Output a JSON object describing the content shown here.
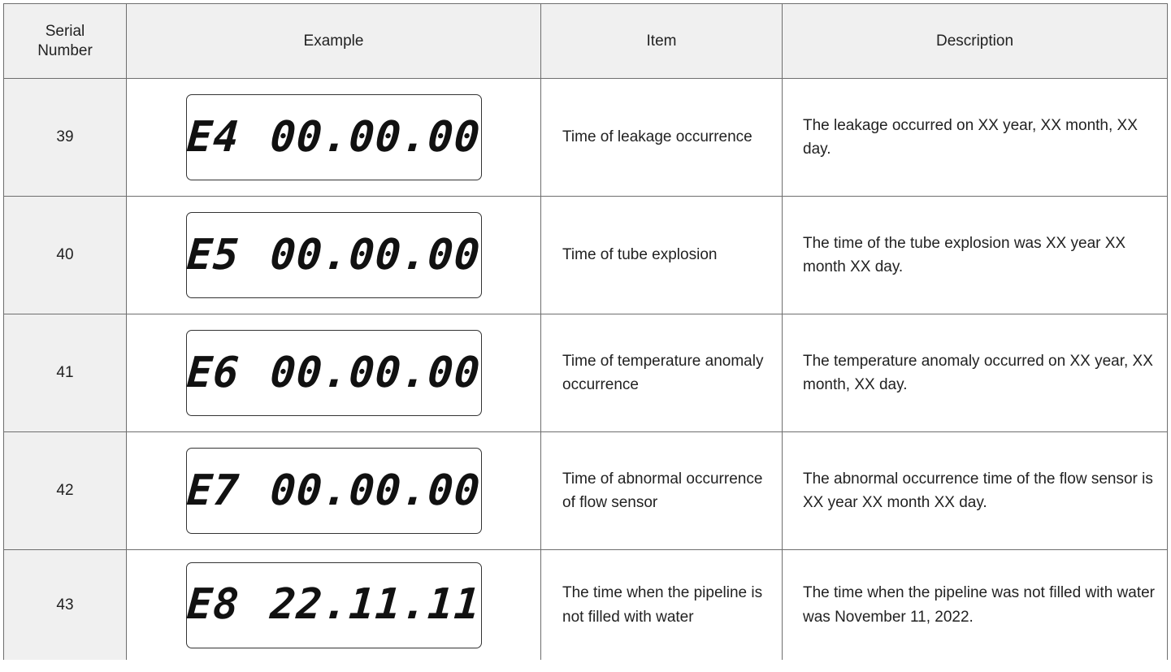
{
  "table": {
    "headers": {
      "serial_line1": "Serial",
      "serial_line2": "Number",
      "example": "Example",
      "item": "Item",
      "description": "Description"
    },
    "rows": [
      {
        "serial": "39",
        "display_code": "E4",
        "display_value": "00.00.00",
        "item": "Time of leakage occurrence",
        "description": "The leakage occurred on XX year, XX month, XX day."
      },
      {
        "serial": "40",
        "display_code": "E5",
        "display_value": "00.00.00",
        "item": "Time of tube explosion",
        "description": "The time of the tube explosion was XX year XX month XX day."
      },
      {
        "serial": "41",
        "display_code": "E6",
        "display_value": "00.00.00",
        "item": "Time of temperature anomaly occurrence",
        "description": "The temperature anomaly occurred on XX year, XX month, XX day."
      },
      {
        "serial": "42",
        "display_code": "E7",
        "display_value": "00.00.00",
        "item": "Time of abnormal occurrence of flow sensor",
        "description": "The abnormal occurrence time of the flow sensor is XX year XX month XX day."
      },
      {
        "serial": "43",
        "display_code": "E8",
        "display_value": "22.11.11",
        "item": "The time when the pipeline is not filled with water",
        "description": "The time when the pipeline was not filled with water was November 11, 2022."
      }
    ]
  }
}
